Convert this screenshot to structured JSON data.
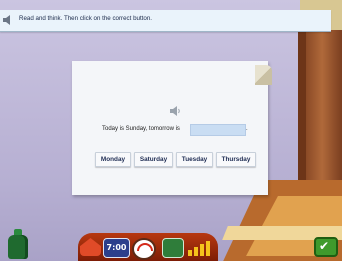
{
  "instruction": {
    "text": "Read and think. Then click on the correct button."
  },
  "exercise": {
    "sentence": "Today is Sunday, tomorrow is",
    "answer_value": "",
    "sentence_end": "."
  },
  "choices": [
    {
      "label": "Monday"
    },
    {
      "label": "Saturday"
    },
    {
      "label": "Tuesday"
    },
    {
      "label": "Thursday"
    }
  ],
  "toolbar": {
    "items": [
      {
        "icon": "home-icon"
      },
      {
        "icon": "clock-icon",
        "text": "7:00"
      },
      {
        "icon": "gauge-icon"
      },
      {
        "icon": "book-icon"
      },
      {
        "icon": "level-bars-icon"
      }
    ]
  },
  "check_button": {
    "icon": "checkmark-icon",
    "glyph": "✔"
  },
  "colors": {
    "background_wall": "#c0b9d9",
    "instruction_bar": "#eaf3fb",
    "card": "#f4f6f9",
    "answer_box": "#c9ddf3",
    "toolbar": "#b73810",
    "check_button": "#3f9a2c"
  }
}
